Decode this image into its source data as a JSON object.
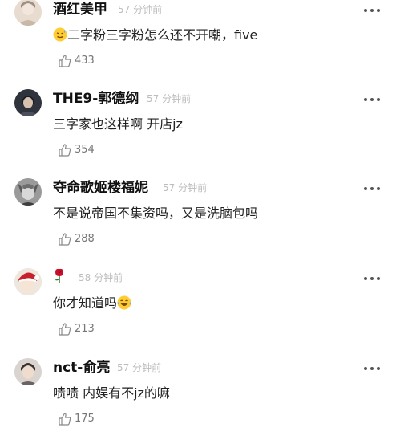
{
  "comments": [
    {
      "username": "酒红美甲",
      "time": "57 分钟前",
      "text_after_emoji": "二字粉三字粉怎么还不开嘲，five",
      "emoji_before": "sweat-smile-emoji",
      "likes": "433",
      "avatar_color": "#c9b8a8"
    },
    {
      "username": "THE9-郭德纲",
      "time": "57 分钟前",
      "text": "三字家也这样啊 开店jz",
      "likes": "354",
      "avatar_color": "#3b3f4a"
    },
    {
      "username": "夺命歌姬楼福妮",
      "time": "57 分钟前",
      "text": "不是说帝国不集资吗，又是洗脑包吗",
      "likes": "288",
      "avatar_color": "#8a8a8a"
    },
    {
      "username_icon": "rose-icon",
      "time": "58 分钟前",
      "text_before_emoji": "你才知道吗",
      "emoji_after": "laughing-tears-emoji",
      "likes": "213",
      "avatar_color": "#d9c2b0"
    },
    {
      "username": "nct-俞亮",
      "time": "57 分钟前",
      "text": "啧啧 内娱有不jz的嘛",
      "likes": "175",
      "avatar_color": "#6b6360"
    }
  ],
  "icons": {
    "like": "thumbs-up-icon",
    "more": "more-dots-icon"
  },
  "colors": {
    "username": "#111111",
    "timestamp": "#bdbdbd",
    "body_text": "#222222",
    "like_count": "#777777",
    "rose": "#c8102e"
  }
}
